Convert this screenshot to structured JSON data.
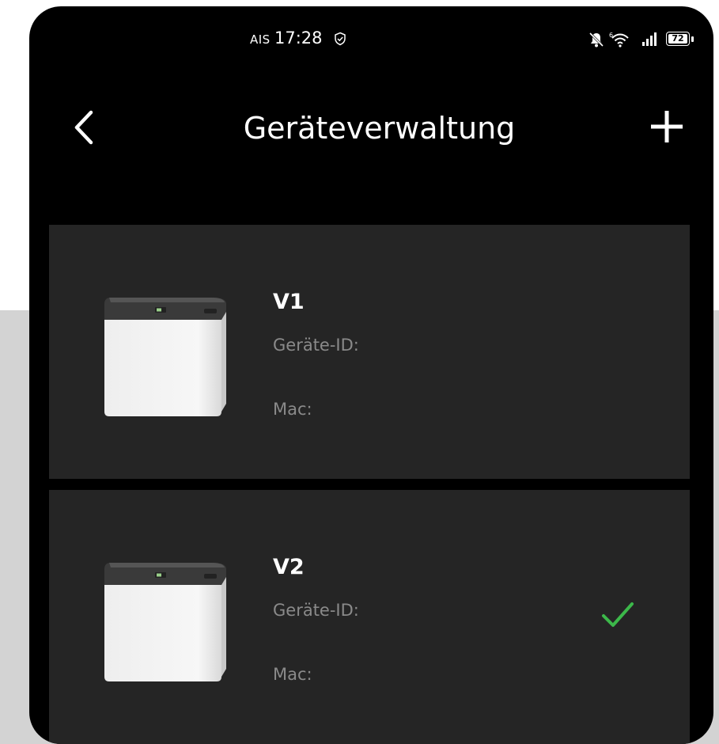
{
  "status_bar": {
    "carrier": "AIS",
    "time": "17:28",
    "battery": "72",
    "icons": [
      "shield-check-icon",
      "mute-bell-icon",
      "wifi-icon",
      "signal-icon",
      "battery-icon"
    ]
  },
  "header": {
    "title": "Geräteverwaltung",
    "back_icon": "chevron-left-icon",
    "add_icon": "plus-icon"
  },
  "devices": [
    {
      "name": "V1",
      "id_label": "Geräte-ID:",
      "mac_label": "Mac:",
      "selected": false
    },
    {
      "name": "V2",
      "id_label": "Geräte-ID:",
      "mac_label": "Mac:",
      "selected": true
    }
  ],
  "colors": {
    "background": "#000000",
    "card": "#252525",
    "label": "#8a8a8a",
    "check": "#3cb84a"
  }
}
